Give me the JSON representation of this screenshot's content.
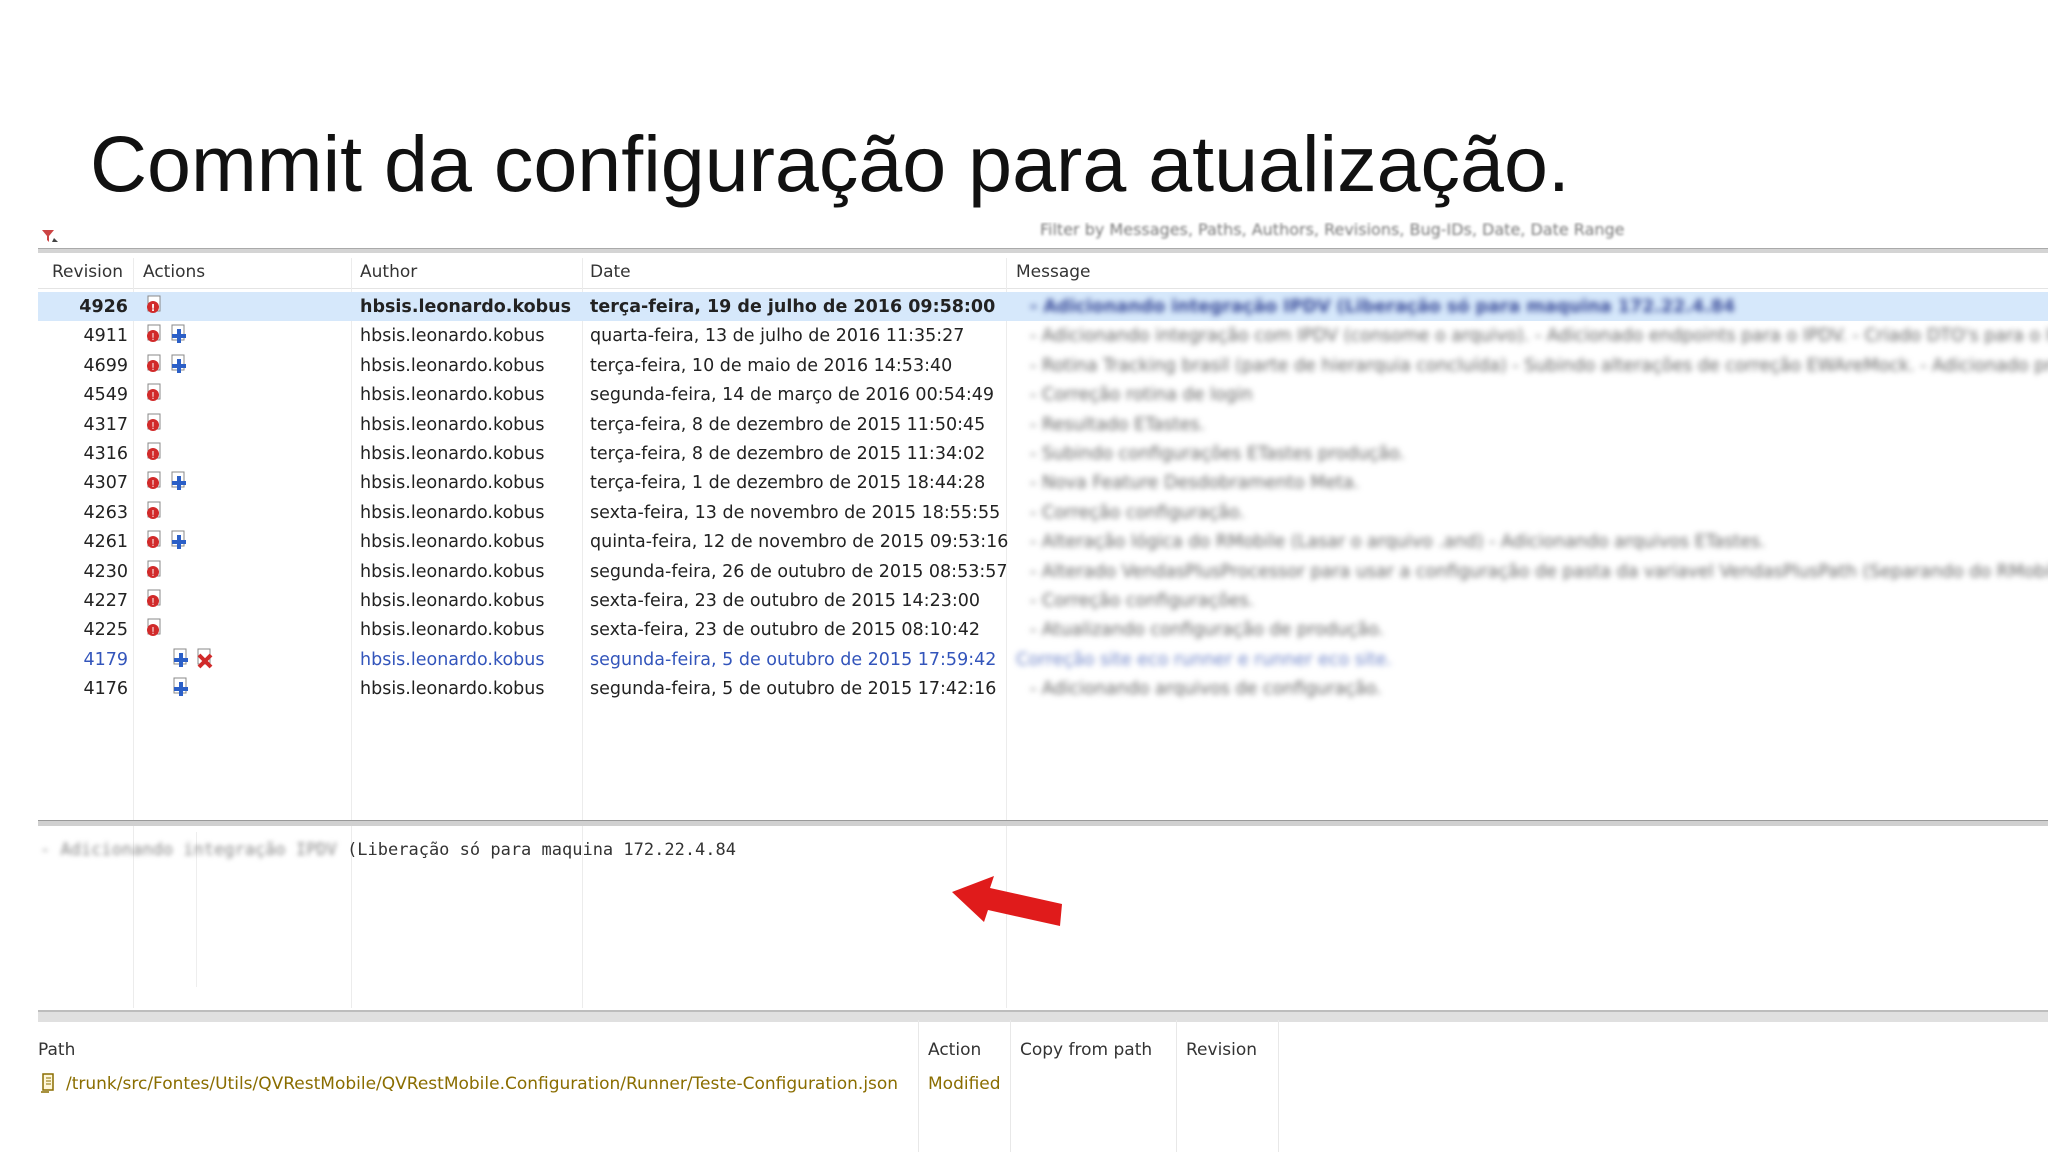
{
  "slide": {
    "title": "Commit da configuração para atualização."
  },
  "toolbar": {
    "filter_placeholder": "Filter by Messages, Paths, Authors, Revisions, Bug-IDs, Date, Date Range"
  },
  "log": {
    "columns": [
      "Revision",
      "Actions",
      "Author",
      "Date",
      "Message"
    ],
    "rows": [
      {
        "revision": "4926",
        "actions": [
          "modified"
        ],
        "author": "hbsis.leonardo.kobus",
        "date": "terça-feira, 19 de julho de 2016 09:58:00",
        "message": "- Adicionando integração IPDV (Liberação só para maquina 172.22.4.84"
      },
      {
        "revision": "4911",
        "actions": [
          "modified",
          "added"
        ],
        "author": "hbsis.leonardo.kobus",
        "date": "quarta-feira, 13 de julho de 2016 11:35:27",
        "message": "- Adicionando integração com IPDV (consome o arquivo). - Adicionado endpoints para o IPDV. - Criado DTO's para o IPDV. -"
      },
      {
        "revision": "4699",
        "actions": [
          "modified",
          "added"
        ],
        "author": "hbsis.leonardo.kobus",
        "date": "terça-feira, 10 de maio de 2016 14:53:40",
        "message": "- Rotina Tracking brasil (parte de hierarquia concluída) - Subindo alterações de correção EWAreMock. - Adicionado projeto pa"
      },
      {
        "revision": "4549",
        "actions": [
          "modified"
        ],
        "author": "hbsis.leonardo.kobus",
        "date": "segunda-feira, 14 de março de 2016 00:54:49",
        "message": "- Correção rotina de login"
      },
      {
        "revision": "4317",
        "actions": [
          "modified"
        ],
        "author": "hbsis.leonardo.kobus",
        "date": "terça-feira, 8 de dezembro de 2015 11:50:45",
        "message": "- Resultado ETastes."
      },
      {
        "revision": "4316",
        "actions": [
          "modified"
        ],
        "author": "hbsis.leonardo.kobus",
        "date": "terça-feira, 8 de dezembro de 2015 11:34:02",
        "message": "- Subindo configurações ETastes produção."
      },
      {
        "revision": "4307",
        "actions": [
          "modified",
          "added"
        ],
        "author": "hbsis.leonardo.kobus",
        "date": "terça-feira, 1 de dezembro de 2015 18:44:28",
        "message": "- Nova Feature Desdobramento Meta."
      },
      {
        "revision": "4263",
        "actions": [
          "modified"
        ],
        "author": "hbsis.leonardo.kobus",
        "date": "sexta-feira, 13 de novembro de 2015 18:55:55",
        "message": "- Correção configuração."
      },
      {
        "revision": "4261",
        "actions": [
          "modified",
          "added"
        ],
        "author": "hbsis.leonardo.kobus",
        "date": "quinta-feira, 12 de novembro de 2015 09:53:16",
        "message": "- Alteração lógica do RMobile (Lasar o arquivo .and) - Adicionando arquivos ETastes."
      },
      {
        "revision": "4230",
        "actions": [
          "modified"
        ],
        "author": "hbsis.leonardo.kobus",
        "date": "segunda-feira, 26 de outubro de 2015 08:53:57",
        "message": "- Alterado VendasPlusProcessor para usar a configuração de pasta da variavel VendasPlusPath (Separando do RMobile)."
      },
      {
        "revision": "4227",
        "actions": [
          "modified"
        ],
        "author": "hbsis.leonardo.kobus",
        "date": "sexta-feira, 23 de outubro de 2015 14:23:00",
        "message": "- Correção configurações."
      },
      {
        "revision": "4225",
        "actions": [
          "modified"
        ],
        "author": "hbsis.leonardo.kobus",
        "date": "sexta-feira, 23 de outubro de 2015 08:10:42",
        "message": "- Atualizando configuração de produção."
      },
      {
        "revision": "4179",
        "actions": [
          "added",
          "deleted"
        ],
        "author": "hbsis.leonardo.kobus",
        "date": "segunda-feira, 5 de outubro de 2015 17:59:42",
        "message": "Correção site eco runner e runner eco site."
      },
      {
        "revision": "4176",
        "actions": [
          "added"
        ],
        "author": "hbsis.leonardo.kobus",
        "date": "segunda-feira, 5 de outubro de 2015 17:42:16",
        "message": "- Adicionando arquivos de configuração."
      }
    ]
  },
  "detail": {
    "blurred_prefix": "- Adicionando integração IPDV",
    "text": "(Liberação só para maquina 172.22.4.84"
  },
  "paths": {
    "columns": [
      "Path",
      "Action",
      "Copy from path",
      "Revision"
    ],
    "rows": [
      {
        "path": "/trunk/src/Fontes/Utils/QVRestMobile/QVRestMobile.Configuration/Runner/Teste-Configuration.json",
        "action": "Modified",
        "copy_from": "",
        "revision": ""
      }
    ]
  },
  "colors": {
    "selected_row": "#d6e8fb",
    "modified_text": "#8a6d00",
    "arrow": "#e01b1b",
    "modified_icon": "#d12a2a",
    "added_icon": "#2b5fc7"
  }
}
